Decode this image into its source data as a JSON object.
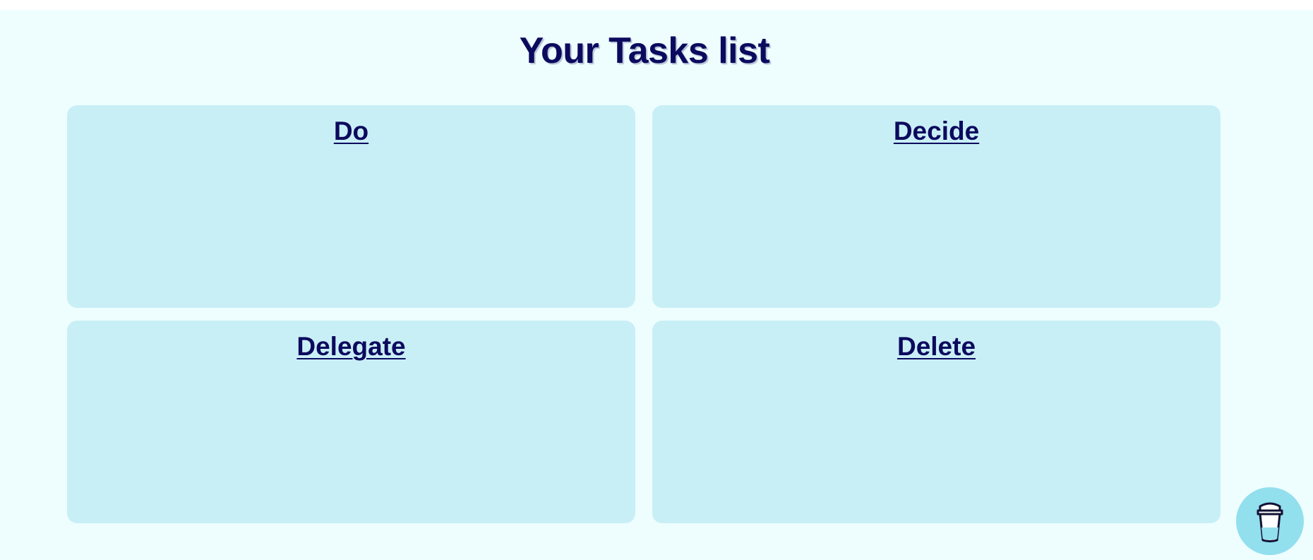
{
  "page": {
    "title": "Your Tasks list"
  },
  "quadrants": [
    {
      "label": "Do"
    },
    {
      "label": "Decide"
    },
    {
      "label": "Delegate"
    },
    {
      "label": "Delete"
    }
  ],
  "floating_button": {
    "icon": "coffee-cup-icon"
  },
  "colors": {
    "background": "#eefefe",
    "panel": "#c9eff6",
    "text": "#0c0a5e",
    "floating_button": "#92dfee"
  }
}
